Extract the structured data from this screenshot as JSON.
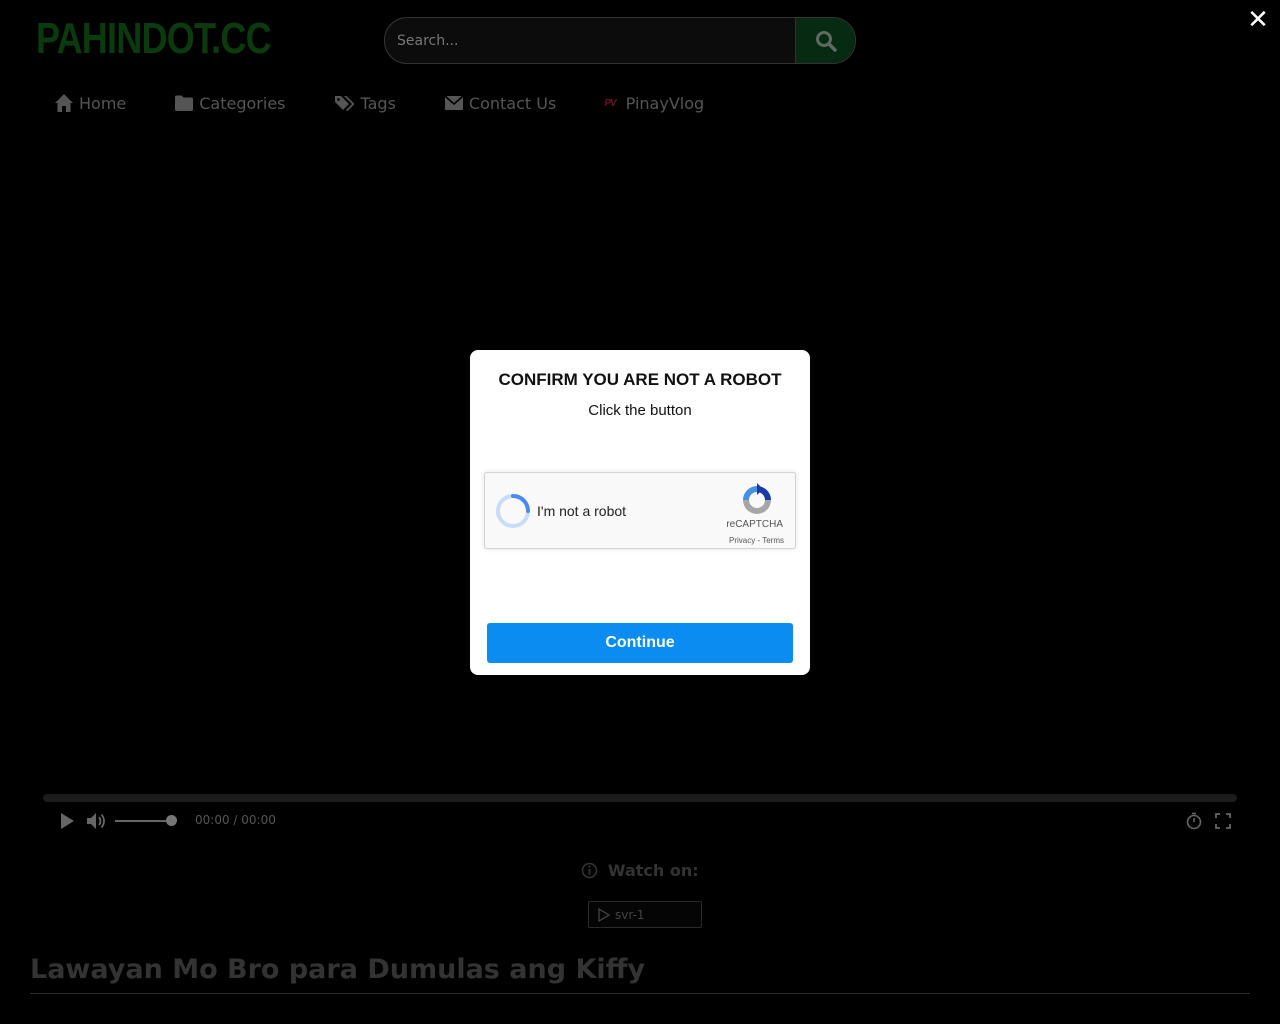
{
  "site": {
    "logo_text": "PAHINDOT.CC"
  },
  "search": {
    "placeholder": "Search..."
  },
  "close_symbol": "✕",
  "nav": {
    "items": [
      {
        "label": "Home",
        "icon": "home-icon"
      },
      {
        "label": "Categories",
        "icon": "folder-icon"
      },
      {
        "label": "Tags",
        "icon": "tags-icon"
      },
      {
        "label": "Contact Us",
        "icon": "envelope-icon"
      },
      {
        "label": "PinayVlog",
        "icon": "pinayvlog-logo-icon",
        "mark": "PV"
      }
    ]
  },
  "modal": {
    "title": "CONFIRM YOU ARE NOT A ROBOT",
    "subtitle": "Click the button",
    "captcha": {
      "label": "I'm not a robot",
      "brand": "reCAPTCHA",
      "links": "Privacy - Terms"
    },
    "continue_label": "Continue",
    "button_color": "#0a8cf0"
  },
  "player": {
    "time": "00:00 / 00:00",
    "volume": 1.0
  },
  "watch": {
    "label": "Watch on:",
    "server_label": "svr-1"
  },
  "video": {
    "title": "Lawayan Mo Bro para Dumulas ang Kiffy"
  }
}
